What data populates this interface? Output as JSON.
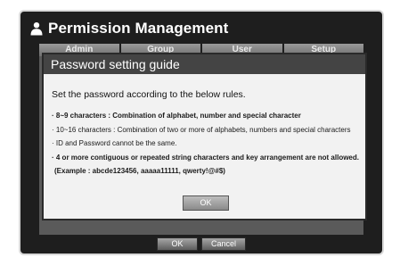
{
  "window": {
    "title": "Permission Management",
    "tabs": [
      "Admin",
      "Group",
      "User",
      "Setup"
    ],
    "buttons": {
      "ok": "OK",
      "cancel": "Cancel"
    }
  },
  "dialog": {
    "title": "Password setting guide",
    "intro": "Set the password according to the below rules.",
    "rules": [
      "· 8~9 characters : Combination of alphabet, number and special character",
      "· 10~16 characters : Combination of two or more of alphabets, numbers and special characters",
      "· ID and Password cannot be the same.",
      "· 4 or more contiguous or repeated string characters and key arrangement are not allowed."
    ],
    "example": "(Example : abcde123456, aaaaa11111, qwerty!@#$)",
    "ok_label": "OK"
  },
  "icons": {
    "title_icon": "user-icon"
  }
}
